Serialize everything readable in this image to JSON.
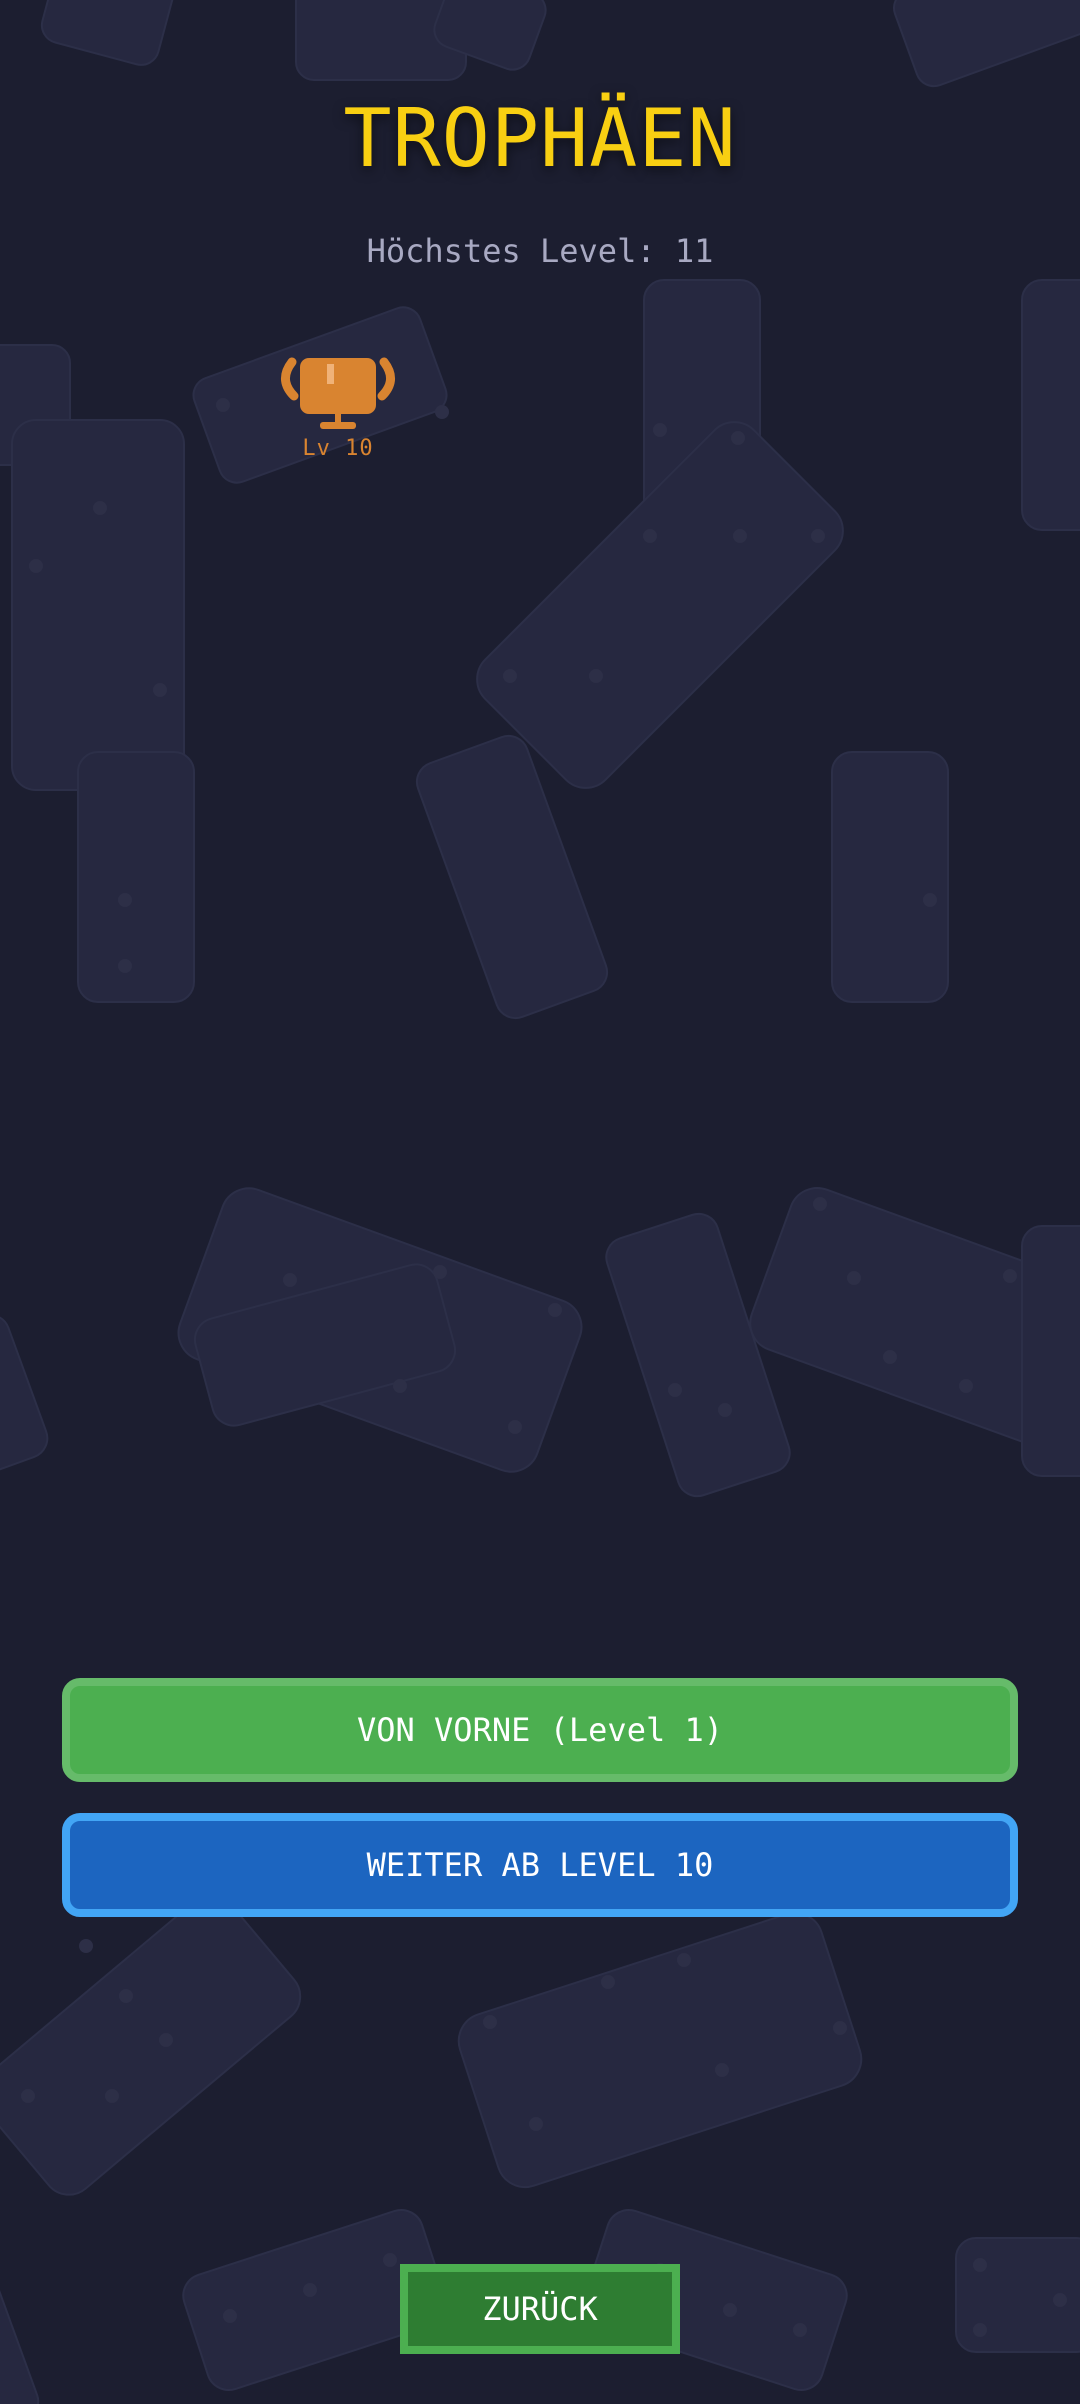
{
  "screen": {
    "title": "TROPHÄEN",
    "highest_level": "Höchstes Level: 11"
  },
  "trophies": [
    {
      "label": "Lv 10",
      "icon": "trophy-icon",
      "color": "#d98430"
    }
  ],
  "buttons": {
    "restart_label": "VON VORNE (Level 1)",
    "continue_label": "WEITER AB LEVEL 10",
    "back_label": "ZURÜCK"
  },
  "colors": {
    "background": "#1c1e30",
    "title": "#f8cf12",
    "restart": "#4caf50",
    "continue": "#1c65c0",
    "back": "#2e7d32"
  }
}
